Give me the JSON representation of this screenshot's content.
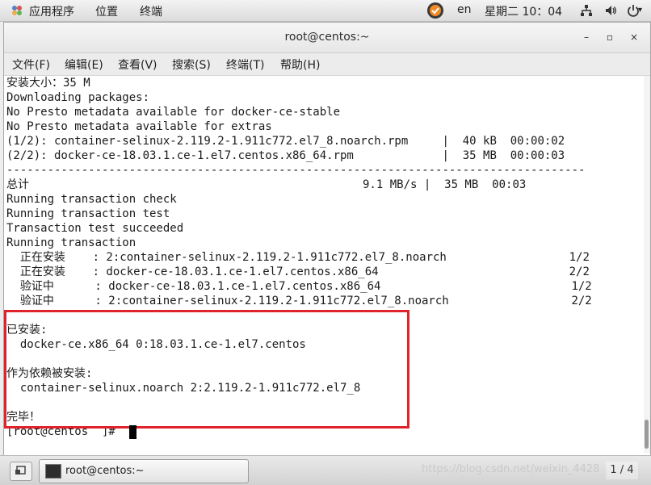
{
  "top_panel": {
    "apps_label": "应用程序",
    "places_label": "位置",
    "terminal_label": "终端",
    "input_method": "en",
    "clock": "星期二 10：04"
  },
  "window": {
    "title": "root@centos:~",
    "minimize_glyph": "–",
    "maximize_glyph": "▫",
    "close_glyph": "×"
  },
  "menubar": {
    "file": "文件(F)",
    "edit": "编辑(E)",
    "view": "查看(V)",
    "search": "搜索(S)",
    "terminal": "终端(T)",
    "help": "帮助(H)"
  },
  "terminal": {
    "lines": [
      "安装大小：35 M",
      "Downloading packages:",
      "No Presto metadata available for docker-ce-stable",
      "No Presto metadata available for extras",
      "(1/2): container-selinux-2.119.2-1.911c772.el7_8.noarch.rpm     |  40 kB  00:00:02",
      "(2/2): docker-ce-18.03.1.ce-1.el7.centos.x86_64.rpm             |  35 MB  00:00:03",
      "-------------------------------------------------------------------------------------",
      "总计                                                 9.1 MB/s |  35 MB  00:03",
      "Running transaction check",
      "Running transaction test",
      "Transaction test succeeded",
      "Running transaction",
      "  正在安装    : 2:container-selinux-2.119.2-1.911c772.el7_8.noarch                  1/2",
      "  正在安装    : docker-ce-18.03.1.ce-1.el7.centos.x86_64                            2/2",
      "  验证中      : docker-ce-18.03.1.ce-1.el7.centos.x86_64                            1/2",
      "  验证中      : 2:container-selinux-2.119.2-1.911c772.el7_8.noarch                  2/2",
      "",
      "已安装:",
      "  docker-ce.x86_64 0:18.03.1.ce-1.el7.centos",
      "",
      "作为依赖被安装:",
      "  container-selinux.noarch 2:2.119.2-1.911c772.el7_8",
      "",
      "完毕！",
      "[root@centos  ]# "
    ]
  },
  "taskbar": {
    "task_label": "root@centos:~",
    "watermark": "https://blog.csdn.net/weixin_4428",
    "workspace": "1 / 4"
  },
  "colors": {
    "highlight_box": "#e0222a",
    "terminal_bg": "#ffffff",
    "terminal_fg": "#1a1a1a"
  }
}
